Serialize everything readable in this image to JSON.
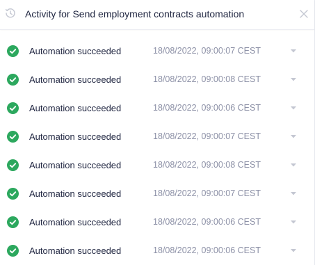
{
  "header": {
    "title": "Activity for Send employment contracts automation",
    "icon": "history-icon",
    "close_icon": "close-icon"
  },
  "colors": {
    "success": "#2ca85e",
    "text": "#1f2540",
    "muted": "#8c90a6",
    "icon_muted": "#c4c7d2"
  },
  "activity": [
    {
      "status": "Automation succeeded",
      "time": "18/08/2022, 09:00:07 CEST"
    },
    {
      "status": "Automation succeeded",
      "time": "18/08/2022, 09:00:08 CEST"
    },
    {
      "status": "Automation succeeded",
      "time": "18/08/2022, 09:00:06 CEST"
    },
    {
      "status": "Automation succeeded",
      "time": "18/08/2022, 09:00:07 CEST"
    },
    {
      "status": "Automation succeeded",
      "time": "18/08/2022, 09:00:08 CEST"
    },
    {
      "status": "Automation succeeded",
      "time": "18/08/2022, 09:00:07 CEST"
    },
    {
      "status": "Automation succeeded",
      "time": "18/08/2022, 09:00:06 CEST"
    },
    {
      "status": "Automation succeeded",
      "time": "18/08/2022, 09:00:06 CEST"
    }
  ]
}
